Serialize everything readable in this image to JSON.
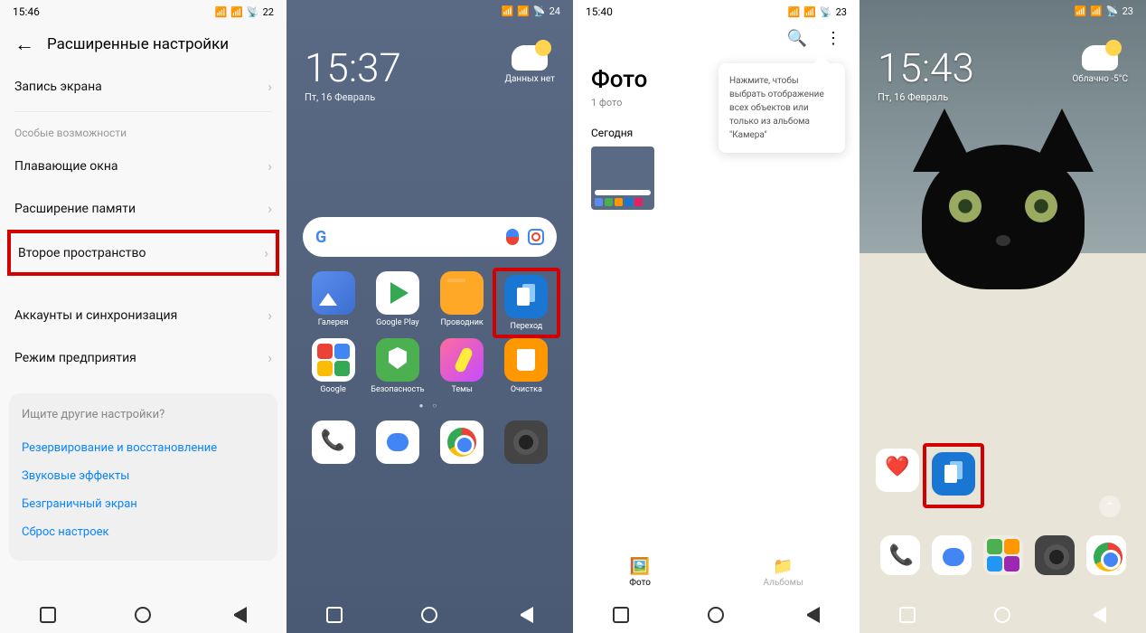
{
  "s1": {
    "time": "15:46",
    "battery": "22",
    "title": "Расширенные настройки",
    "rows": {
      "r1": "Запись экрана",
      "section": "Особые возможности",
      "r2": "Плавающие окна",
      "r3": "Расширение памяти",
      "r4": "Второе пространство",
      "r5": "Аккаунты и синхронизация",
      "r6": "Режим предприятия"
    },
    "tips": {
      "q": "Ищите другие настройки?",
      "l1": "Резервирование и восстановление",
      "l2": "Звуковые эффекты",
      "l3": "Безграничный экран",
      "l4": "Сброс настроек"
    }
  },
  "s2": {
    "battery": "24",
    "time": "15:37",
    "date": "Пт, 16 Февраль",
    "weather": "Данных нет",
    "apps": {
      "a1": "Галерея",
      "a2": "Google Play",
      "a3": "Проводник",
      "a4": "Переход",
      "a5": "Google",
      "a6": "Безопасность",
      "a7": "Темы",
      "a8": "Очистка"
    }
  },
  "s3": {
    "time": "15:40",
    "battery": "23",
    "title": "Фото",
    "tooltip": "Нажмите, чтобы выбрать отображение всех объектов или только из альбома \"Камера\"",
    "count": "1 фото",
    "day": "Сегодня",
    "tabs": {
      "t1": "Фото",
      "t2": "Альбомы"
    }
  },
  "s4": {
    "battery": "23",
    "time": "15:43",
    "date": "Пт, 16 Февраль",
    "weather": "Облачно  -5°C"
  }
}
